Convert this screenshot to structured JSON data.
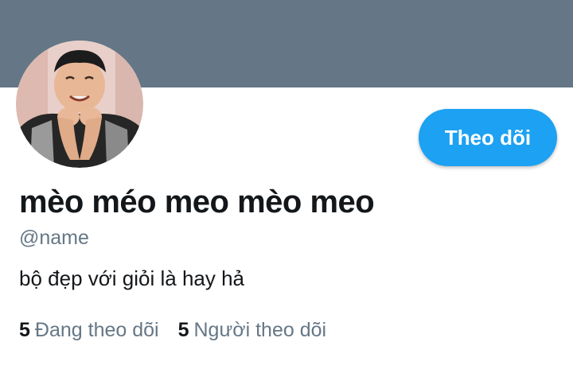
{
  "profile": {
    "display_name": "mèo méo meo mèo meo",
    "handle": "@name",
    "bio": "bộ đẹp với giỏi là hay hả"
  },
  "actions": {
    "follow_label": "Theo dõi"
  },
  "stats": {
    "following_count": "5",
    "following_label": "Đang theo dõi",
    "followers_count": "5",
    "followers_label": "Người theo dõi"
  },
  "colors": {
    "cover": "#657786",
    "accent": "#1da1f2",
    "primary_text": "#14171a",
    "secondary_text": "#657786"
  },
  "icons": {
    "avatar": "profile-photo"
  }
}
